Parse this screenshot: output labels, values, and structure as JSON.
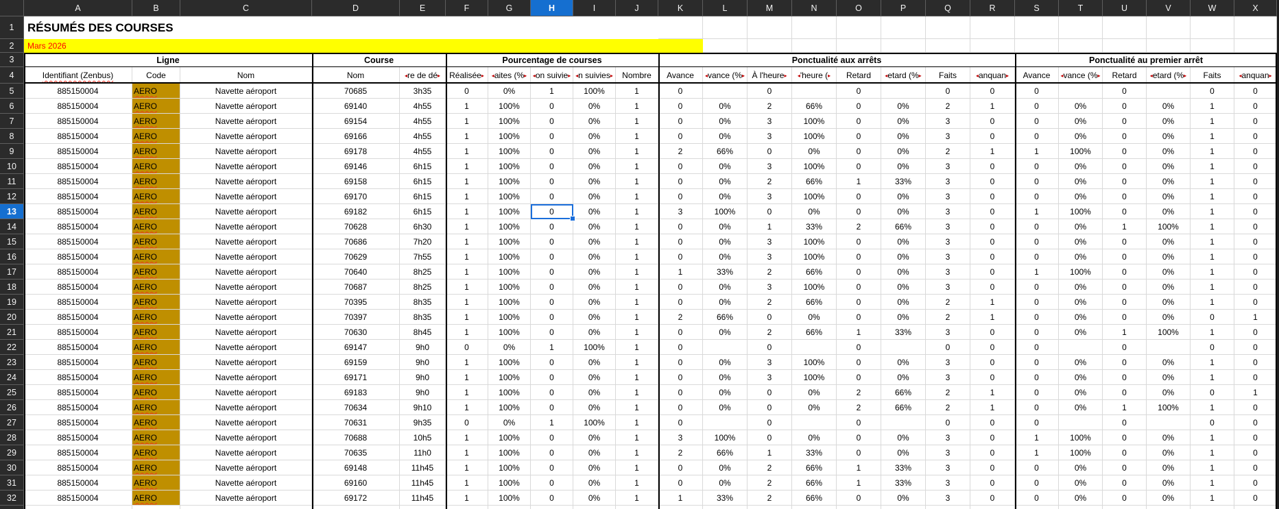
{
  "sheet": {
    "title": "RÉSUMÉS DES COURSES",
    "subtitle": "Mars 2026",
    "top_row_numbers": [
      "1",
      "2",
      "3",
      "4"
    ],
    "column_letters": [
      "A",
      "B",
      "C",
      "D",
      "E",
      "F",
      "G",
      "H",
      "I",
      "J",
      "K",
      "L",
      "M",
      "N",
      "O",
      "P",
      "Q",
      "R",
      "S",
      "T",
      "U",
      "V",
      "W",
      "X"
    ],
    "selection": {
      "column": "H",
      "row": "13",
      "cell_value": "0"
    },
    "groups": [
      {
        "label": "Ligne",
        "slug": "ligne",
        "cols": 3
      },
      {
        "label": "Course",
        "slug": "course",
        "cols": 2
      },
      {
        "label": "Pourcentage de courses",
        "slug": "pourcentage-de-courses",
        "cols": 5
      },
      {
        "label": "Ponctualité aux arrêts",
        "slug": "ponctualite-aux-arrets",
        "cols": 8
      },
      {
        "label": "Ponctualité au premier arrêt",
        "slug": "ponctualite-au-premier-arret",
        "cols": 6
      }
    ],
    "headers": [
      {
        "label": "Identifiant (Zenbus)",
        "clip": "",
        "spellcheck": true
      },
      {
        "label": "Code",
        "clip": ""
      },
      {
        "label": "Nom",
        "clip": ""
      },
      {
        "label": "Nom",
        "clip": ""
      },
      {
        "label": "re de dé",
        "clip": "lr"
      },
      {
        "label": "Réalisée",
        "clip": "r"
      },
      {
        "label": "aites (%",
        "clip": "lr"
      },
      {
        "label": "on suivie",
        "clip": "lr"
      },
      {
        "label": "n suivies",
        "clip": "lr"
      },
      {
        "label": "Nombre",
        "clip": ""
      },
      {
        "label": "Avance",
        "clip": ""
      },
      {
        "label": "vance (%",
        "clip": "lr"
      },
      {
        "label": "À l'heure",
        "clip": "r"
      },
      {
        "label": "'heure (",
        "clip": "lr"
      },
      {
        "label": "Retard",
        "clip": ""
      },
      {
        "label": "etard (%",
        "clip": "lr"
      },
      {
        "label": "Faits",
        "clip": ""
      },
      {
        "label": "anquan",
        "clip": "lr"
      },
      {
        "label": "Avance",
        "clip": ""
      },
      {
        "label": "vance (%",
        "clip": "lr"
      },
      {
        "label": "Retard",
        "clip": ""
      },
      {
        "label": "etard (%",
        "clip": "lr"
      },
      {
        "label": "Faits",
        "clip": ""
      },
      {
        "label": "anquan",
        "clip": "lr"
      }
    ],
    "rows": [
      {
        "n": "5",
        "cells": [
          "885150004",
          "AERO",
          "Navette aéroport",
          "70685",
          "3h35",
          "0",
          "0%",
          "1",
          "100%",
          "1",
          "0",
          "",
          "0",
          "",
          "0",
          "",
          "0",
          "0",
          "0",
          "",
          "0",
          "",
          "0",
          "0"
        ]
      },
      {
        "n": "6",
        "cells": [
          "885150004",
          "AERO",
          "Navette aéroport",
          "69140",
          "4h55",
          "1",
          "100%",
          "0",
          "0%",
          "1",
          "0",
          "0%",
          "2",
          "66%",
          "0",
          "0%",
          "2",
          "1",
          "0",
          "0%",
          "0",
          "0%",
          "1",
          "0"
        ]
      },
      {
        "n": "7",
        "cells": [
          "885150004",
          "AERO",
          "Navette aéroport",
          "69154",
          "4h55",
          "1",
          "100%",
          "0",
          "0%",
          "1",
          "0",
          "0%",
          "3",
          "100%",
          "0",
          "0%",
          "3",
          "0",
          "0",
          "0%",
          "0",
          "0%",
          "1",
          "0"
        ]
      },
      {
        "n": "8",
        "cells": [
          "885150004",
          "AERO",
          "Navette aéroport",
          "69166",
          "4h55",
          "1",
          "100%",
          "0",
          "0%",
          "1",
          "0",
          "0%",
          "3",
          "100%",
          "0",
          "0%",
          "3",
          "0",
          "0",
          "0%",
          "0",
          "0%",
          "1",
          "0"
        ]
      },
      {
        "n": "9",
        "cells": [
          "885150004",
          "AERO",
          "Navette aéroport",
          "69178",
          "4h55",
          "1",
          "100%",
          "0",
          "0%",
          "1",
          "2",
          "66%",
          "0",
          "0%",
          "0",
          "0%",
          "2",
          "1",
          "1",
          "100%",
          "0",
          "0%",
          "1",
          "0"
        ]
      },
      {
        "n": "10",
        "cells": [
          "885150004",
          "AERO",
          "Navette aéroport",
          "69146",
          "6h15",
          "1",
          "100%",
          "0",
          "0%",
          "1",
          "0",
          "0%",
          "3",
          "100%",
          "0",
          "0%",
          "3",
          "0",
          "0",
          "0%",
          "0",
          "0%",
          "1",
          "0"
        ]
      },
      {
        "n": "11",
        "cells": [
          "885150004",
          "AERO",
          "Navette aéroport",
          "69158",
          "6h15",
          "1",
          "100%",
          "0",
          "0%",
          "1",
          "0",
          "0%",
          "2",
          "66%",
          "1",
          "33%",
          "3",
          "0",
          "0",
          "0%",
          "0",
          "0%",
          "1",
          "0"
        ]
      },
      {
        "n": "12",
        "cells": [
          "885150004",
          "AERO",
          "Navette aéroport",
          "69170",
          "6h15",
          "1",
          "100%",
          "0",
          "0%",
          "1",
          "0",
          "0%",
          "3",
          "100%",
          "0",
          "0%",
          "3",
          "0",
          "0",
          "0%",
          "0",
          "0%",
          "1",
          "0"
        ]
      },
      {
        "n": "13",
        "cells": [
          "885150004",
          "AERO",
          "Navette aéroport",
          "69182",
          "6h15",
          "1",
          "100%",
          "0",
          "0%",
          "1",
          "3",
          "100%",
          "0",
          "0%",
          "0",
          "0%",
          "3",
          "0",
          "1",
          "100%",
          "0",
          "0%",
          "1",
          "0"
        ]
      },
      {
        "n": "14",
        "cells": [
          "885150004",
          "AERO",
          "Navette aéroport",
          "70628",
          "6h30",
          "1",
          "100%",
          "0",
          "0%",
          "1",
          "0",
          "0%",
          "1",
          "33%",
          "2",
          "66%",
          "3",
          "0",
          "0",
          "0%",
          "1",
          "100%",
          "1",
          "0"
        ]
      },
      {
        "n": "15",
        "cells": [
          "885150004",
          "AERO",
          "Navette aéroport",
          "70686",
          "7h20",
          "1",
          "100%",
          "0",
          "0%",
          "1",
          "0",
          "0%",
          "3",
          "100%",
          "0",
          "0%",
          "3",
          "0",
          "0",
          "0%",
          "0",
          "0%",
          "1",
          "0"
        ]
      },
      {
        "n": "16",
        "cells": [
          "885150004",
          "AERO",
          "Navette aéroport",
          "70629",
          "7h55",
          "1",
          "100%",
          "0",
          "0%",
          "1",
          "0",
          "0%",
          "3",
          "100%",
          "0",
          "0%",
          "3",
          "0",
          "0",
          "0%",
          "0",
          "0%",
          "1",
          "0"
        ]
      },
      {
        "n": "17",
        "cells": [
          "885150004",
          "AERO",
          "Navette aéroport",
          "70640",
          "8h25",
          "1",
          "100%",
          "0",
          "0%",
          "1",
          "1",
          "33%",
          "2",
          "66%",
          "0",
          "0%",
          "3",
          "0",
          "1",
          "100%",
          "0",
          "0%",
          "1",
          "0"
        ]
      },
      {
        "n": "18",
        "cells": [
          "885150004",
          "AERO",
          "Navette aéroport",
          "70687",
          "8h25",
          "1",
          "100%",
          "0",
          "0%",
          "1",
          "0",
          "0%",
          "3",
          "100%",
          "0",
          "0%",
          "3",
          "0",
          "0",
          "0%",
          "0",
          "0%",
          "1",
          "0"
        ]
      },
      {
        "n": "19",
        "cells": [
          "885150004",
          "AERO",
          "Navette aéroport",
          "70395",
          "8h35",
          "1",
          "100%",
          "0",
          "0%",
          "1",
          "0",
          "0%",
          "2",
          "66%",
          "0",
          "0%",
          "2",
          "1",
          "0",
          "0%",
          "0",
          "0%",
          "1",
          "0"
        ]
      },
      {
        "n": "20",
        "cells": [
          "885150004",
          "AERO",
          "Navette aéroport",
          "70397",
          "8h35",
          "1",
          "100%",
          "0",
          "0%",
          "1",
          "2",
          "66%",
          "0",
          "0%",
          "0",
          "0%",
          "2",
          "1",
          "0",
          "0%",
          "0",
          "0%",
          "0",
          "1"
        ]
      },
      {
        "n": "21",
        "cells": [
          "885150004",
          "AERO",
          "Navette aéroport",
          "70630",
          "8h45",
          "1",
          "100%",
          "0",
          "0%",
          "1",
          "0",
          "0%",
          "2",
          "66%",
          "1",
          "33%",
          "3",
          "0",
          "0",
          "0%",
          "1",
          "100%",
          "1",
          "0"
        ]
      },
      {
        "n": "22",
        "cells": [
          "885150004",
          "AERO",
          "Navette aéroport",
          "69147",
          "9h0",
          "0",
          "0%",
          "1",
          "100%",
          "1",
          "0",
          "",
          "0",
          "",
          "0",
          "",
          "0",
          "0",
          "0",
          "",
          "0",
          "",
          "0",
          "0"
        ]
      },
      {
        "n": "23",
        "cells": [
          "885150004",
          "AERO",
          "Navette aéroport",
          "69159",
          "9h0",
          "1",
          "100%",
          "0",
          "0%",
          "1",
          "0",
          "0%",
          "3",
          "100%",
          "0",
          "0%",
          "3",
          "0",
          "0",
          "0%",
          "0",
          "0%",
          "1",
          "0"
        ]
      },
      {
        "n": "24",
        "cells": [
          "885150004",
          "AERO",
          "Navette aéroport",
          "69171",
          "9h0",
          "1",
          "100%",
          "0",
          "0%",
          "1",
          "0",
          "0%",
          "3",
          "100%",
          "0",
          "0%",
          "3",
          "0",
          "0",
          "0%",
          "0",
          "0%",
          "1",
          "0"
        ]
      },
      {
        "n": "25",
        "cells": [
          "885150004",
          "AERO",
          "Navette aéroport",
          "69183",
          "9h0",
          "1",
          "100%",
          "0",
          "0%",
          "1",
          "0",
          "0%",
          "0",
          "0%",
          "2",
          "66%",
          "2",
          "1",
          "0",
          "0%",
          "0",
          "0%",
          "0",
          "1"
        ]
      },
      {
        "n": "26",
        "cells": [
          "885150004",
          "AERO",
          "Navette aéroport",
          "70634",
          "9h10",
          "1",
          "100%",
          "0",
          "0%",
          "1",
          "0",
          "0%",
          "0",
          "0%",
          "2",
          "66%",
          "2",
          "1",
          "0",
          "0%",
          "1",
          "100%",
          "1",
          "0"
        ]
      },
      {
        "n": "27",
        "cells": [
          "885150004",
          "AERO",
          "Navette aéroport",
          "70631",
          "9h35",
          "0",
          "0%",
          "1",
          "100%",
          "1",
          "0",
          "",
          "0",
          "",
          "0",
          "",
          "0",
          "0",
          "0",
          "",
          "0",
          "",
          "0",
          "0"
        ]
      },
      {
        "n": "28",
        "cells": [
          "885150004",
          "AERO",
          "Navette aéroport",
          "70688",
          "10h5",
          "1",
          "100%",
          "0",
          "0%",
          "1",
          "3",
          "100%",
          "0",
          "0%",
          "0",
          "0%",
          "3",
          "0",
          "1",
          "100%",
          "0",
          "0%",
          "1",
          "0"
        ]
      },
      {
        "n": "29",
        "cells": [
          "885150004",
          "AERO",
          "Navette aéroport",
          "70635",
          "11h0",
          "1",
          "100%",
          "0",
          "0%",
          "1",
          "2",
          "66%",
          "1",
          "33%",
          "0",
          "0%",
          "3",
          "0",
          "1",
          "100%",
          "0",
          "0%",
          "1",
          "0"
        ]
      },
      {
        "n": "30",
        "cells": [
          "885150004",
          "AERO",
          "Navette aéroport",
          "69148",
          "11h45",
          "1",
          "100%",
          "0",
          "0%",
          "1",
          "0",
          "0%",
          "2",
          "66%",
          "1",
          "33%",
          "3",
          "0",
          "0",
          "0%",
          "0",
          "0%",
          "1",
          "0"
        ]
      },
      {
        "n": "31",
        "cells": [
          "885150004",
          "AERO",
          "Navette aéroport",
          "69160",
          "11h45",
          "1",
          "100%",
          "0",
          "0%",
          "1",
          "0",
          "0%",
          "2",
          "66%",
          "1",
          "33%",
          "3",
          "0",
          "0",
          "0%",
          "0",
          "0%",
          "1",
          "0"
        ]
      },
      {
        "n": "32",
        "cells": [
          "885150004",
          "AERO",
          "Navette aéroport",
          "69172",
          "11h45",
          "1",
          "100%",
          "0",
          "0%",
          "1",
          "1",
          "33%",
          "2",
          "66%",
          "0",
          "0%",
          "3",
          "0",
          "0",
          "0%",
          "0",
          "0%",
          "1",
          "0"
        ]
      }
    ]
  },
  "colors": {
    "accent_blue": "#156FD0",
    "selection_border": "#1A6EDB",
    "code_cell_bg": "#BF8F00",
    "subtitle_bg": "#FFFF00",
    "subtitle_text": "#FF0000",
    "header_strip_bg": "#2B2B2B",
    "gridline": "#D9D9D9",
    "section_border": "#000000"
  }
}
